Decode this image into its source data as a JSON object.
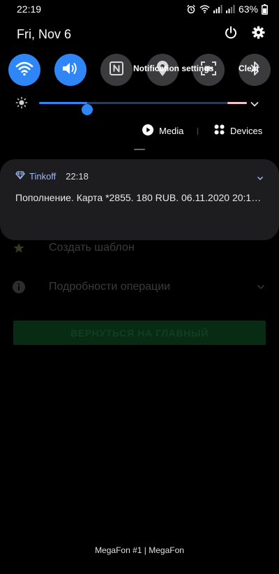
{
  "status_bar": {
    "time": "22:19",
    "battery": "63%",
    "icons": [
      "alarm-icon",
      "wifi-icon",
      "signal-icon",
      "signal-icon",
      "battery-icon"
    ]
  },
  "quick_settings": {
    "date": "Fri, Nov 6",
    "toggles": [
      {
        "name": "wifi",
        "icon": "wifi-icon",
        "on": true
      },
      {
        "name": "sound",
        "icon": "sound-icon",
        "on": true
      },
      {
        "name": "nfc",
        "icon": "nfc-icon",
        "on": false
      },
      {
        "name": "location",
        "icon": "location-icon",
        "on": false
      },
      {
        "name": "screen-recorder",
        "icon": "screen-recorder-icon",
        "on": false
      },
      {
        "name": "bluetooth",
        "icon": "bluetooth-icon",
        "on": false
      }
    ],
    "brightness_level": 0.23,
    "media_label": "Media",
    "devices_label": "Devices"
  },
  "notification": {
    "app": "Tinkoff",
    "time": "22:18",
    "text": "Пополнение. Карта *2855. 180 RUB. 06.11.2020 20:18. Баланс",
    "settings_label": "Notification settings",
    "clear_label": "Clear"
  },
  "background_app": {
    "items": [
      {
        "label": "Создать шаблон",
        "icon": "star-icon"
      },
      {
        "label": "Подробности операции",
        "icon": "info-icon"
      }
    ],
    "button_label": "ВЕРНУТЬСЯ НА ГЛАВНЫЙ"
  },
  "carrier_text": "MegaFon #1 | MegaFon",
  "colors": {
    "accent": "#2f86f6",
    "toggle_off": "#3b3b3d",
    "card": "#1d1d1f",
    "app_name": "#9fb9ef"
  }
}
